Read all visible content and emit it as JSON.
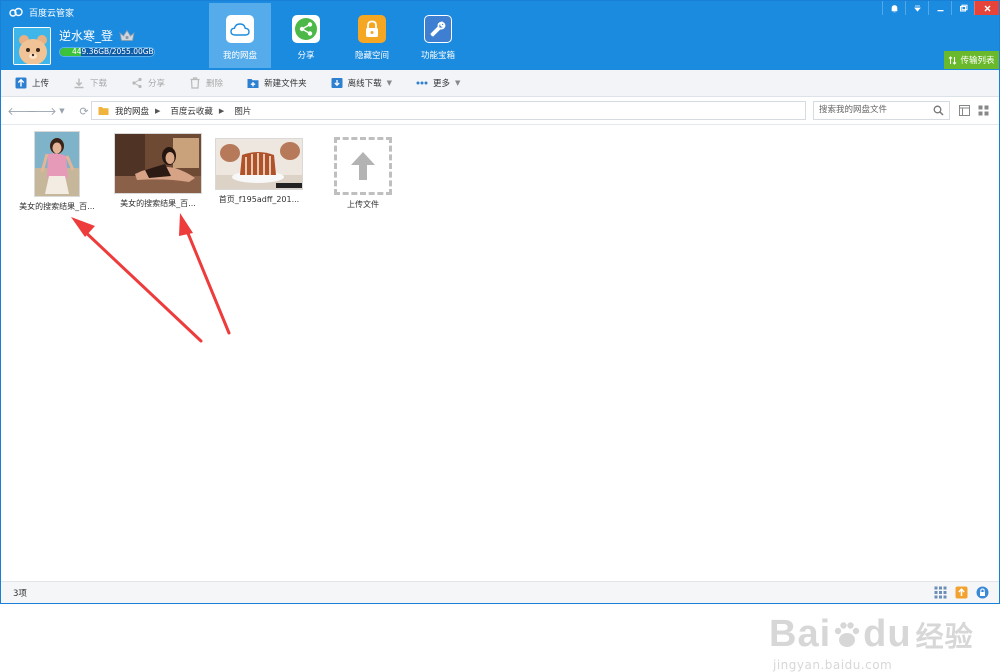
{
  "app": {
    "title": "百度云管家"
  },
  "user": {
    "name": "逆水寒_登",
    "quota_text": "449.36GB/2055.00GB",
    "quota_fraction": 0.22
  },
  "nav_tabs": [
    {
      "label": "我的网盘",
      "icon": "cloud-icon",
      "active": true
    },
    {
      "label": "分享",
      "icon": "share-icon",
      "active": false
    },
    {
      "label": "隐藏空间",
      "icon": "lock-icon",
      "active": false
    },
    {
      "label": "功能宝箱",
      "icon": "toolbox-icon",
      "active": false
    }
  ],
  "transfer_label": "传输列表",
  "toolbar": {
    "upload": "上传",
    "download": "下载",
    "share": "分享",
    "delete": "删除",
    "new_folder": "新建文件夹",
    "offline_download": "离线下载",
    "more": "更多"
  },
  "breadcrumb": [
    "我的网盘",
    "百度云收藏",
    "图片"
  ],
  "search": {
    "placeholder": "搜索我的网盘文件"
  },
  "files": [
    {
      "name": "美女的搜索结果_百..."
    },
    {
      "name": "美女的搜索结果_百..."
    },
    {
      "name": "首页_f195adff_201..."
    }
  ],
  "upload_tile_label": "上传文件",
  "status": {
    "count_text": "3项"
  },
  "watermark": {
    "brand": "Bai",
    "brand2": "du",
    "cn": "经验",
    "url": "jingyan.baidu.com"
  },
  "colors": {
    "header_blue": "#1b8be0",
    "active_tab": "#56aceb",
    "transfer_green": "#6ab82c",
    "arrow_red": "#ee3b3b"
  }
}
